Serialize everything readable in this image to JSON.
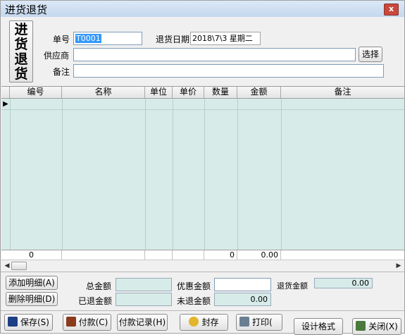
{
  "window": {
    "title": "进货退货",
    "close_label": "x"
  },
  "big_button": {
    "lines": [
      "进",
      "货",
      "退",
      "货"
    ]
  },
  "form": {
    "order_no_label": "单号",
    "order_no_value": "T0001",
    "return_date_label": "退货日期",
    "return_date_value": "2018\\7\\3  星期二",
    "supplier_label": "供应商",
    "supplier_value": "",
    "select_button": "选择",
    "remark_label": "备注",
    "remark_value": ""
  },
  "grid": {
    "columns": [
      "编号",
      "名称",
      "单位",
      "单价",
      "数量",
      "金额",
      "备注"
    ],
    "row_indicator": "▶",
    "summary": {
      "id_count": "0",
      "quantity_total": "0",
      "amount_total": "0.00"
    }
  },
  "scrollbar": {
    "left_arrow": "◀",
    "right_arrow": "▶"
  },
  "totals": {
    "add_detail_button": "添加明细(A)",
    "delete_detail_button": "删除明细(D)",
    "total_amount_label": "总金额",
    "total_amount_value": "",
    "discount_amount_label": "优惠金额",
    "discount_amount_value": "",
    "return_amount_label": "退货金额",
    "return_amount_value": "0.00",
    "refunded_amount_label": "已退金额",
    "refunded_amount_value": "",
    "unrefunded_amount_label": "未退金额",
    "unrefunded_amount_value": "0.00"
  },
  "footer": {
    "save_button": "保存(S)",
    "payment_button": "付款(C)",
    "payment_record_button": "付款记录(H)",
    "seal_button": "封存",
    "print_button": "打印(",
    "design_format_button": "设计格式",
    "close_button": "关闭(X)"
  },
  "colors": {
    "grid_bg": "#d7ebe8",
    "title_bg": "#c5d8ee",
    "close_red": "#c9483c"
  }
}
